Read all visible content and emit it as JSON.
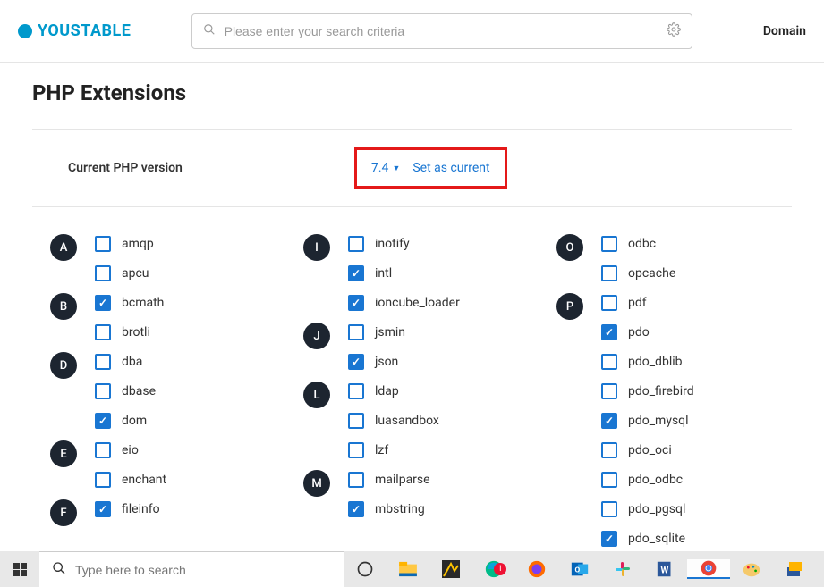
{
  "header": {
    "logo_text": "YOUSTABLE",
    "search_placeholder": "Please enter your search criteria",
    "nav_label": "Domain"
  },
  "page": {
    "title": "PHP Extensions",
    "version_label": "Current PHP version",
    "version_value": "7.4",
    "set_current_label": "Set as current"
  },
  "columns": [
    {
      "groups": [
        {
          "letter": "A",
          "items": [
            {
              "name": "amqp",
              "checked": false
            },
            {
              "name": "apcu",
              "checked": false
            }
          ]
        },
        {
          "letter": "B",
          "items": [
            {
              "name": "bcmath",
              "checked": true
            },
            {
              "name": "brotli",
              "checked": false
            }
          ]
        },
        {
          "letter": "D",
          "items": [
            {
              "name": "dba",
              "checked": false
            },
            {
              "name": "dbase",
              "checked": false
            },
            {
              "name": "dom",
              "checked": true
            }
          ]
        },
        {
          "letter": "E",
          "items": [
            {
              "name": "eio",
              "checked": false
            },
            {
              "name": "enchant",
              "checked": false
            }
          ]
        },
        {
          "letter": "F",
          "items": [
            {
              "name": "fileinfo",
              "checked": true
            }
          ]
        }
      ]
    },
    {
      "groups": [
        {
          "letter": "I",
          "items": [
            {
              "name": "inotify",
              "checked": false
            },
            {
              "name": "intl",
              "checked": true
            },
            {
              "name": "ioncube_loader",
              "checked": true
            }
          ]
        },
        {
          "letter": "J",
          "items": [
            {
              "name": "jsmin",
              "checked": false
            },
            {
              "name": "json",
              "checked": true
            }
          ]
        },
        {
          "letter": "L",
          "items": [
            {
              "name": "ldap",
              "checked": false
            },
            {
              "name": "luasandbox",
              "checked": false
            },
            {
              "name": "lzf",
              "checked": false
            }
          ]
        },
        {
          "letter": "M",
          "items": [
            {
              "name": "mailparse",
              "checked": false
            },
            {
              "name": "mbstring",
              "checked": true
            }
          ]
        }
      ]
    },
    {
      "groups": [
        {
          "letter": "O",
          "items": [
            {
              "name": "odbc",
              "checked": false
            },
            {
              "name": "opcache",
              "checked": false
            }
          ]
        },
        {
          "letter": "P",
          "items": [
            {
              "name": "pdf",
              "checked": false
            },
            {
              "name": "pdo",
              "checked": true
            },
            {
              "name": "pdo_dblib",
              "checked": false
            },
            {
              "name": "pdo_firebird",
              "checked": false
            },
            {
              "name": "pdo_mysql",
              "checked": true
            },
            {
              "name": "pdo_oci",
              "checked": false
            },
            {
              "name": "pdo_odbc",
              "checked": false
            },
            {
              "name": "pdo_pgsql",
              "checked": false
            },
            {
              "name": "pdo_sqlite",
              "checked": true
            }
          ]
        }
      ]
    }
  ],
  "taskbar": {
    "search_placeholder": "Type here to search",
    "badge_count": "1"
  }
}
